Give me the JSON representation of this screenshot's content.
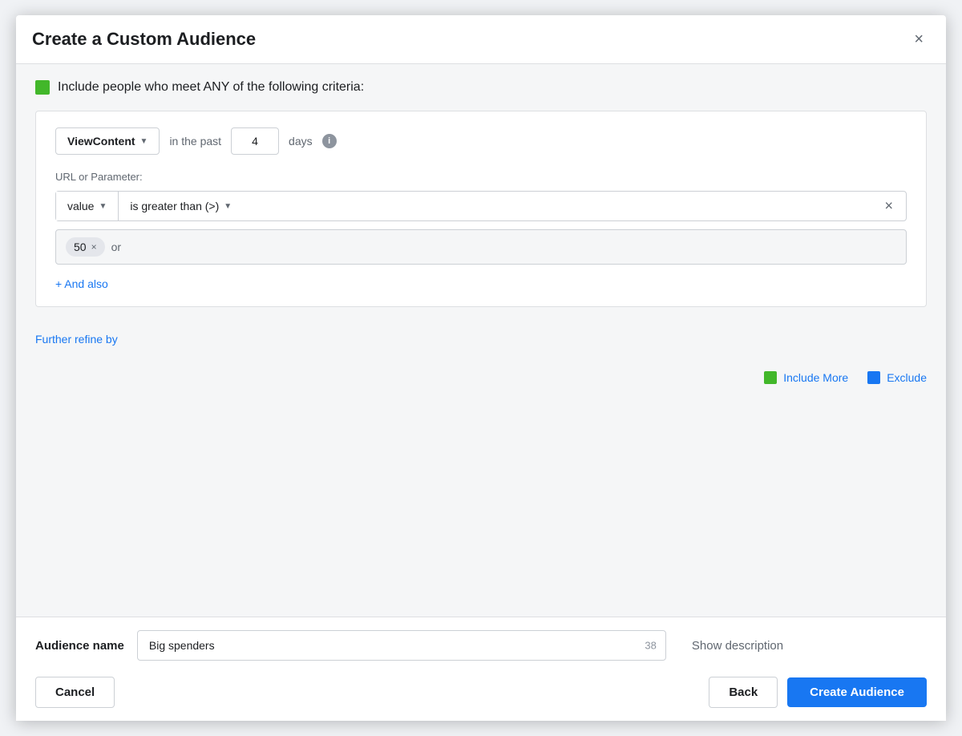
{
  "modal": {
    "title": "Create a Custom Audience",
    "close_label": "×"
  },
  "include_section": {
    "icon_color": "#42b72a",
    "text": "Include people who meet ANY of the following criteria:"
  },
  "criteria": {
    "event_dropdown": {
      "label": "ViewContent",
      "chevron": "▼"
    },
    "in_the_past": "in the past",
    "days_value": "4",
    "days_label": "days",
    "info_label": "i",
    "url_param_label": "URL or Parameter:",
    "param_dropdown": {
      "label": "value",
      "chevron": "▼"
    },
    "condition_dropdown": {
      "label": "is greater than (>)",
      "chevron": "▼"
    },
    "remove_label": "×",
    "value_tag": "50",
    "tag_remove": "×",
    "or_label": "or",
    "and_also_label": "+ And also"
  },
  "further_refine": {
    "label": "Further refine by"
  },
  "include_more": {
    "label": "Include More"
  },
  "exclude": {
    "label": "Exclude"
  },
  "footer": {
    "audience_name_label": "Audience name",
    "audience_name_value": "Big spenders",
    "char_count": "38",
    "show_description_label": "Show description",
    "cancel_label": "Cancel",
    "back_label": "Back",
    "create_label": "Create Audience"
  }
}
